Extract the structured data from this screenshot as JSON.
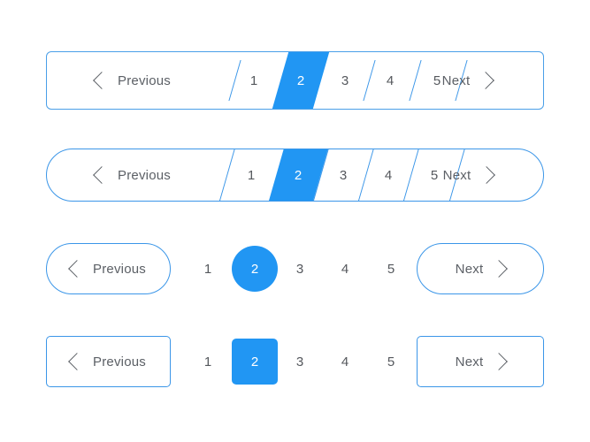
{
  "common": {
    "previous_label": "Previous",
    "next_label": "Next",
    "prev_icon": "chevron-left-icon",
    "next_icon": "chevron-right-icon",
    "divider_icon": "slash-divider",
    "active_page": "2",
    "pages": [
      "1",
      "2",
      "3",
      "4",
      "5"
    ]
  },
  "colors": {
    "accent": "#2196f3",
    "border": "#3b96e8",
    "border_soft": "#4a9fe8",
    "text": "#55585d",
    "label_text": "#5c6066",
    "active_text": "#ffffff",
    "background": "#ffffff"
  },
  "variants": [
    {
      "name": "slashed-square-bar",
      "previous_label": "Previous",
      "next_label": "Next",
      "pages": [
        "1",
        "2",
        "3",
        "4",
        "5"
      ],
      "active_page": "2",
      "shape": "parallelogram",
      "container": "rounded-rectangle"
    },
    {
      "name": "slashed-pill-bar",
      "previous_label": "Previous",
      "next_label": "Next",
      "pages": [
        "1",
        "2",
        "3",
        "4",
        "5"
      ],
      "active_page": "2",
      "shape": "parallelogram",
      "container": "pill"
    },
    {
      "name": "pill-buttons-circle-active",
      "previous_label": "Previous",
      "next_label": "Next",
      "pages": [
        "1",
        "2",
        "3",
        "4",
        "5"
      ],
      "active_page": "2",
      "shape": "circle",
      "container": "detached-pill-buttons"
    },
    {
      "name": "rect-buttons-square-active",
      "previous_label": "Previous",
      "next_label": "Next",
      "pages": [
        "1",
        "2",
        "3",
        "4",
        "5"
      ],
      "active_page": "2",
      "shape": "rounded-square",
      "container": "detached-rect-buttons"
    }
  ]
}
